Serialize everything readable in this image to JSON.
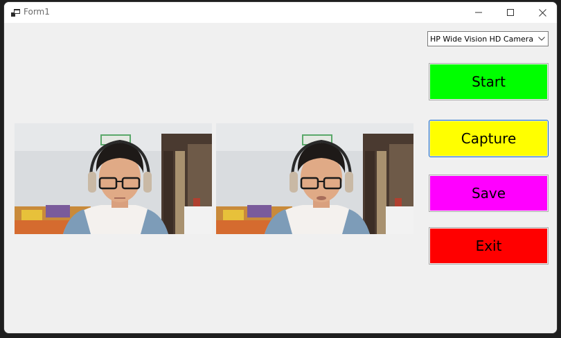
{
  "window": {
    "title": "Form1"
  },
  "titlebar": {
    "app_icon": "form-icon",
    "minimize_icon": "minimize-icon",
    "maximize_icon": "maximize-icon",
    "close_icon": "close-icon"
  },
  "camera_select": {
    "selected": "HP Wide Vision HD Camera",
    "arrow_icon": "chevron-down-icon"
  },
  "buttons": {
    "start": {
      "label": "Start",
      "color": "#00ff00"
    },
    "capture": {
      "label": "Capture",
      "color": "#ffff00"
    },
    "save": {
      "label": "Save",
      "color": "#ff00ff"
    },
    "exit": {
      "label": "Exit",
      "color": "#ff0000"
    }
  },
  "pictures": {
    "live_preview": "webcam-live-image",
    "captured": "webcam-captured-image"
  }
}
